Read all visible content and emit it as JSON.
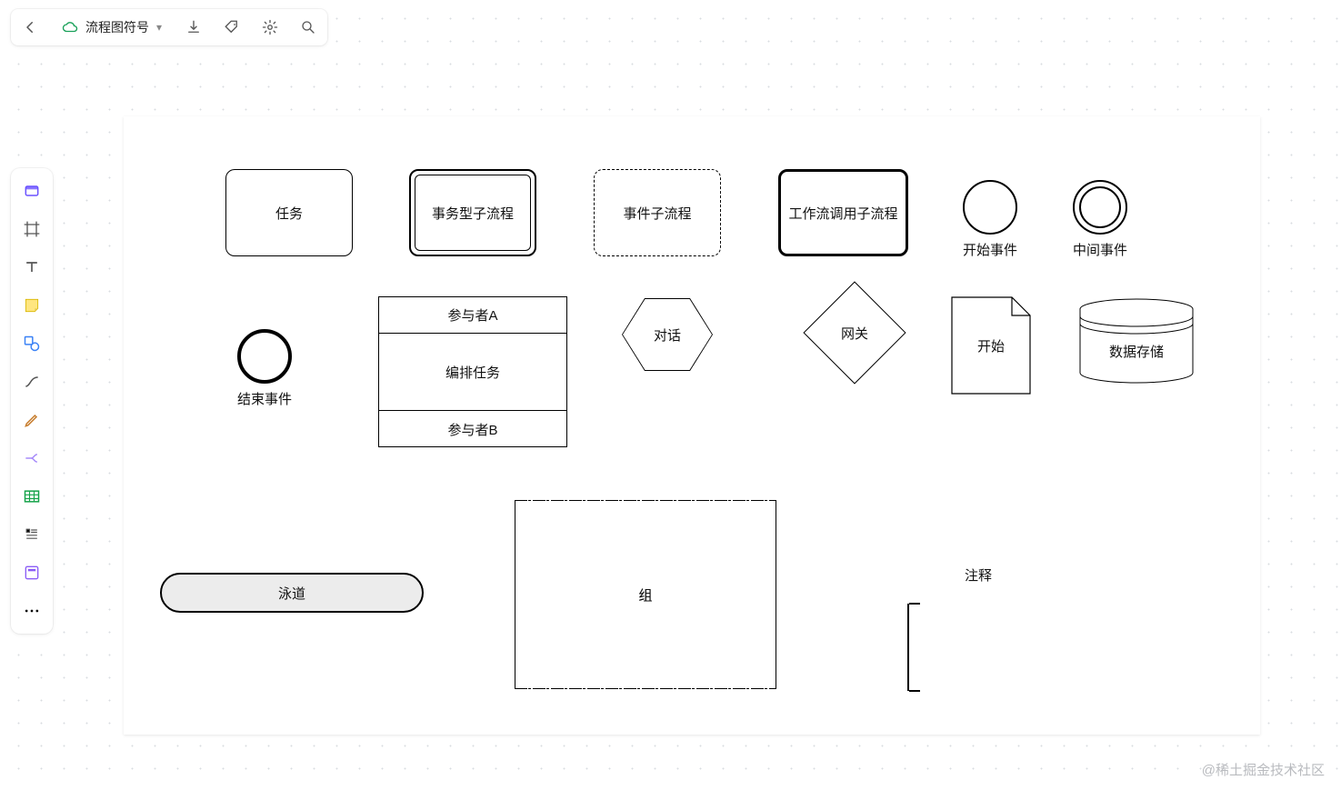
{
  "topbar": {
    "title": "流程图符号"
  },
  "shapes": {
    "task": "任务",
    "transaction_subprocess": "事务型子流程",
    "event_subprocess": "事件子流程",
    "call_activity": "工作流调用子流程",
    "start_event": "开始事件",
    "intermediate_event": "中间事件",
    "end_event": "结束事件",
    "participant_a": "参与者A",
    "orchestration_task": "编排任务",
    "participant_b": "参与者B",
    "conversation": "对话",
    "gateway": "网关",
    "start": "开始",
    "data_store": "数据存储",
    "lane": "泳道",
    "group": "组",
    "annotation": "注释"
  },
  "watermark": "@稀土掘金技术社区"
}
